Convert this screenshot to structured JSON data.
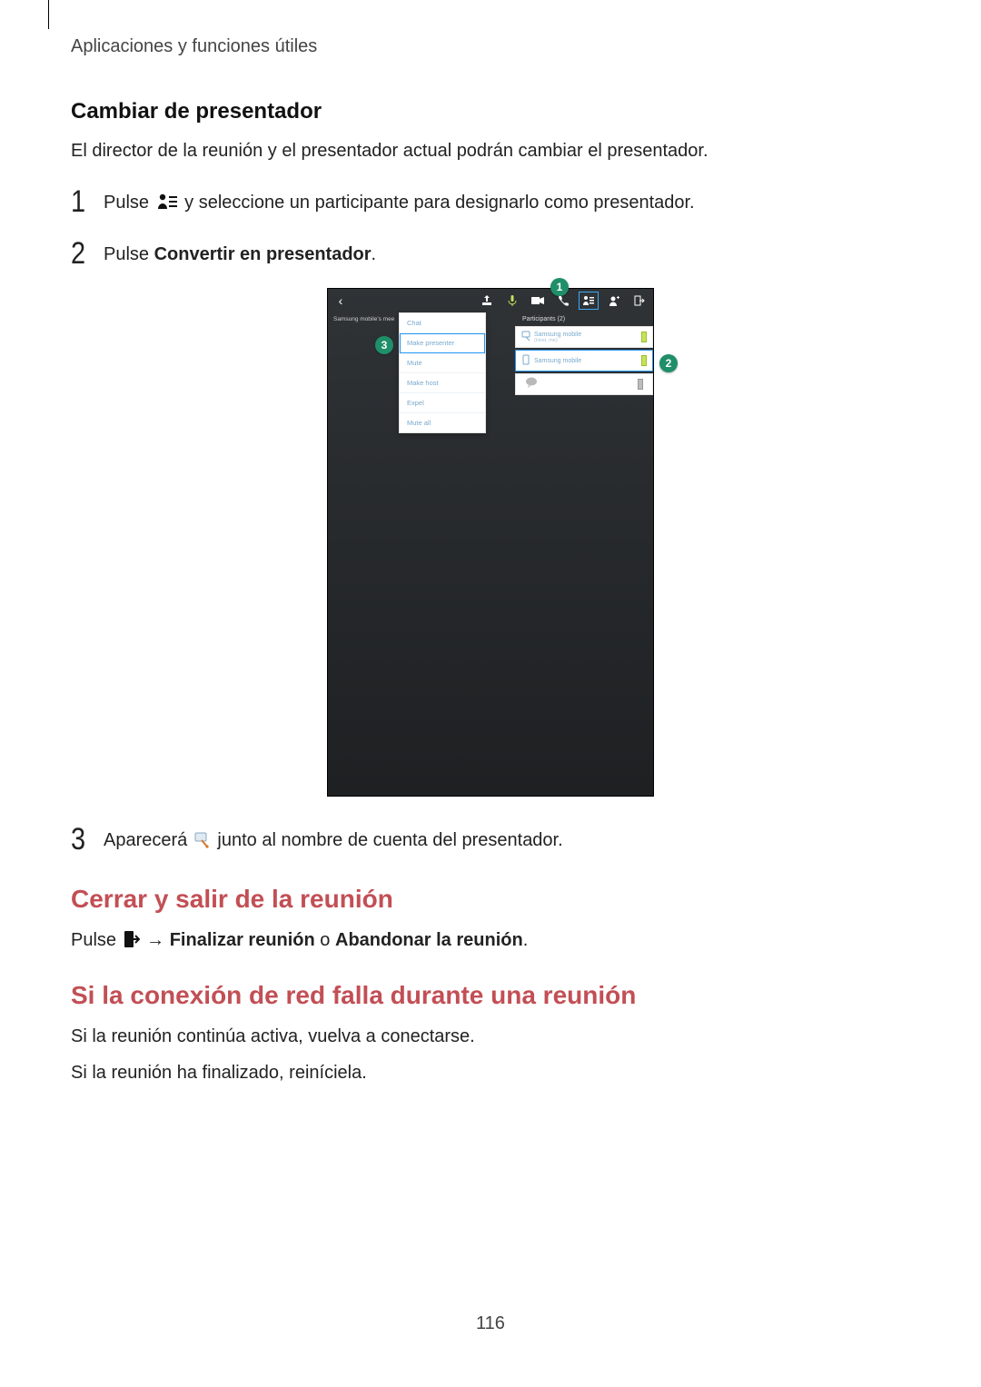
{
  "header": {
    "runhead": "Aplicaciones y funciones útiles"
  },
  "section1": {
    "title": "Cambiar de presentador",
    "intro": "El director de la reunión y el presentador actual podrán cambiar el presentador.",
    "steps": {
      "n1": "1",
      "s1_a": "Pulse ",
      "s1_b": " y seleccione un participante para designarlo como presentador.",
      "n2": "2",
      "s2_a": "Pulse ",
      "s2_bold": "Convertir en presentador",
      "s2_c": ".",
      "n3": "3",
      "s3_a": "Aparecerá ",
      "s3_b": " junto al nombre de cuenta del presentador."
    }
  },
  "screenshot": {
    "sub_label": "Samsung mobile's mee",
    "ctx": [
      "Chat",
      "Make presenter",
      "Mute",
      "Make host",
      "Expel",
      "Mute all"
    ],
    "rp_title": "Participants (2)",
    "rp_rows": [
      {
        "name": "Samsung mobile",
        "sub": "(Host, me)"
      },
      {
        "name": "Samsung mobile",
        "sub": ""
      }
    ],
    "badges": {
      "b1": "1",
      "b2": "2",
      "b3": "3"
    }
  },
  "section2": {
    "title": "Cerrar y salir de la reunión",
    "p_a": "Pulse ",
    "arrow": " → ",
    "p_bold1": "Finalizar reunión",
    "p_mid": " o ",
    "p_bold2": "Abandonar la reunión",
    "p_end": "."
  },
  "section3": {
    "title": "Si la conexión de red falla durante una reunión",
    "p1": "Si la reunión continúa activa, vuelva a conectarse.",
    "p2": "Si la reunión ha finalizado, reiníciela."
  },
  "page_number": "116"
}
